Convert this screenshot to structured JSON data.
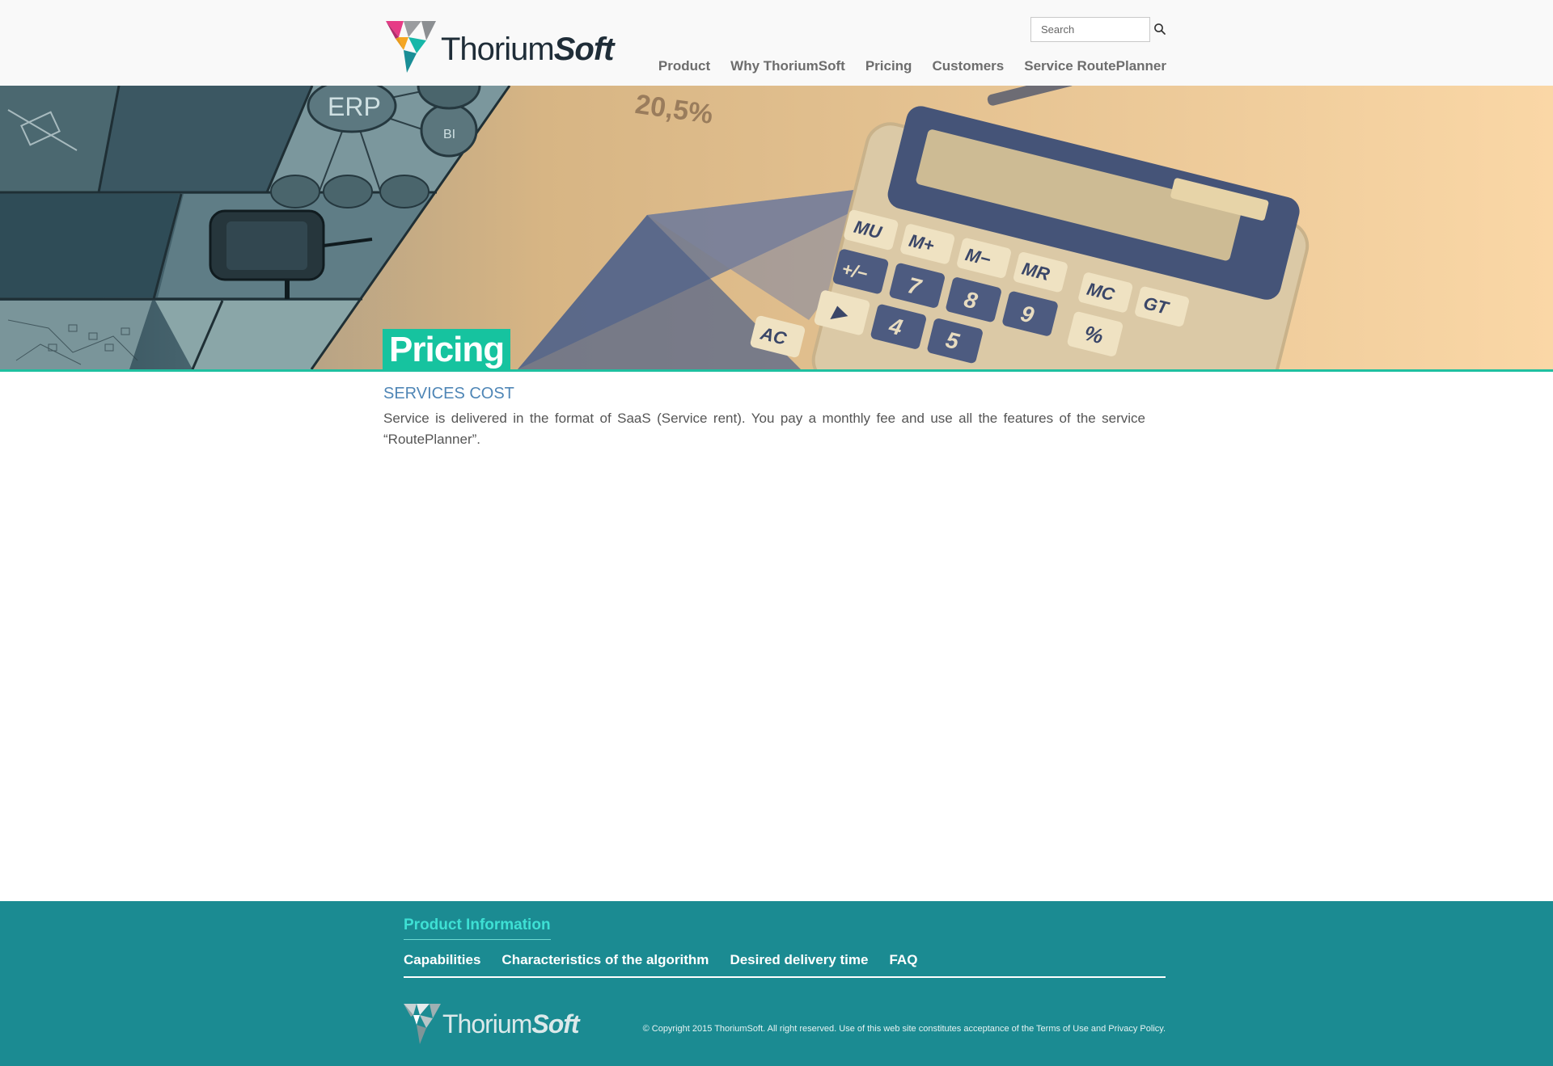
{
  "brand": {
    "name_part1": "Thorium",
    "name_part2": "Soft"
  },
  "search": {
    "placeholder": "Search",
    "button_icon": "search-icon"
  },
  "nav": {
    "items": [
      {
        "label": "Product"
      },
      {
        "label": "Why ThoriumSoft"
      },
      {
        "label": "Pricing"
      },
      {
        "label": "Customers"
      },
      {
        "label": "Service RoutePlanner"
      }
    ]
  },
  "hero": {
    "title": "Pricing",
    "image_text": {
      "erp": "ERP",
      "bi": "BI",
      "percent": "20,5%",
      "keys": [
        "MU",
        "M+",
        "M−",
        "MR",
        "MC",
        "GT",
        "+/−",
        "7",
        "8",
        "9",
        "%",
        "▶",
        "4",
        "5",
        "AC"
      ]
    }
  },
  "content": {
    "heading": "SERVICES COST",
    "body": "Service is delivered in the format of SaaS (Service rent). You pay a monthly fee and use all the features of the service “RoutePlanner”."
  },
  "footer": {
    "heading": "Product Information",
    "links": [
      {
        "label": "Capabilities"
      },
      {
        "label": "Characteristics of the algorithm"
      },
      {
        "label": "Desired delivery time"
      },
      {
        "label": "FAQ"
      }
    ],
    "copyright": "© Copyright 2015 ThoriumSoft. All right reserved. Use of this web site constitutes acceptance of the Terms of Use and Privacy Policy."
  },
  "colors": {
    "accent_green": "#16c39f",
    "footer_bg": "#1b8b92",
    "heading_blue": "#4f86b6",
    "footer_heading": "#3ee0d4"
  }
}
